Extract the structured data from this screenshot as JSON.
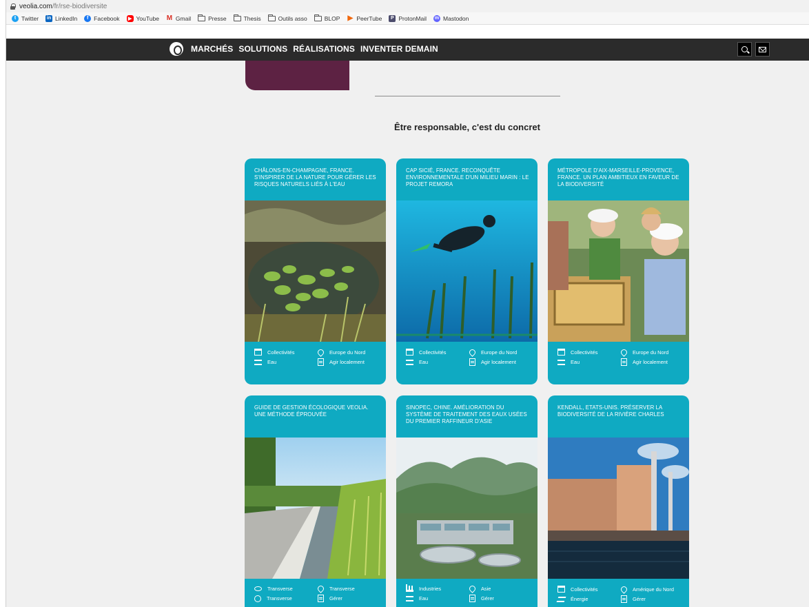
{
  "browser": {
    "url_host": "veolia.com",
    "url_path": "/fr/rse-biodiversite"
  },
  "bookmarks": [
    {
      "label": "Twitter",
      "icon": "twitter-icon",
      "color": "#1da1f2"
    },
    {
      "label": "LinkedIn",
      "icon": "linkedin-icon",
      "color": "#0a66c2"
    },
    {
      "label": "Facebook",
      "icon": "facebook-icon",
      "color": "#1877f2"
    },
    {
      "label": "YouTube",
      "icon": "youtube-icon",
      "color": "#ff0000"
    },
    {
      "label": "Gmail",
      "icon": "gmail-icon",
      "color": "#d93025"
    },
    {
      "label": "Presse",
      "icon": "folder-icon"
    },
    {
      "label": "Thesis",
      "icon": "folder-icon"
    },
    {
      "label": "Outils asso",
      "icon": "folder-icon"
    },
    {
      "label": "BLOP",
      "icon": "folder-icon"
    },
    {
      "label": "PeerTube",
      "icon": "peertube-icon",
      "color": "#f1680d"
    },
    {
      "label": "ProtonMail",
      "icon": "protonmail-icon",
      "color": "#4d4d6d"
    },
    {
      "label": "Mastodon",
      "icon": "mastodon-icon",
      "color": "#6364ff"
    }
  ],
  "nav": {
    "links": [
      "MARCHÉS",
      "SOLUTIONS",
      "RÉALISATIONS",
      "INVENTER DEMAIN"
    ]
  },
  "section_title": "Être responsable, c'est du concret",
  "cards": [
    {
      "title": "CHÂLONS-EN-CHAMPAGNE, FRANCE. S'INSPIRER DE LA NATURE POUR GÉRER LES RISQUES NATURELS LIÉS À L'EAU",
      "tags": [
        {
          "label": "Collectivités",
          "icon": "building-icon"
        },
        {
          "label": "Europe du Nord",
          "icon": "location-icon"
        },
        {
          "label": "Eau",
          "icon": "water-icon"
        },
        {
          "label": "Agir localement",
          "icon": "document-icon"
        }
      ]
    },
    {
      "title": "CAP SICIÉ, FRANCE. RECONQUÊTE ENVIRONNEMENTALE D'UN MILIEU MARIN : LE PROJET REMORA",
      "tags": [
        {
          "label": "Collectivités",
          "icon": "building-icon"
        },
        {
          "label": "Europe du Nord",
          "icon": "location-icon"
        },
        {
          "label": "Eau",
          "icon": "water-icon"
        },
        {
          "label": "Agir localement",
          "icon": "document-icon"
        }
      ]
    },
    {
      "title": "MÉTROPOLE D'AIX-MARSEILLE-PROVENCE, FRANCE. UN PLAN AMBITIEUX EN FAVEUR DE LA BIODIVERSITÉ",
      "tags": [
        {
          "label": "Collectivités",
          "icon": "building-icon"
        },
        {
          "label": "Europe du Nord",
          "icon": "location-icon"
        },
        {
          "label": "Eau",
          "icon": "water-icon"
        },
        {
          "label": "Agir localement",
          "icon": "document-icon"
        }
      ]
    },
    {
      "title": "GUIDE DE GESTION ÉCOLOGIQUE VEOLIA. UNE MÉTHODE ÉPROUVÉE",
      "tags": [
        {
          "label": "Transverse",
          "icon": "eye-icon"
        },
        {
          "label": "Transverse",
          "icon": "location-icon"
        },
        {
          "label": "Transverse",
          "icon": "veolia-circle-icon"
        },
        {
          "label": "Gérer",
          "icon": "document-icon"
        }
      ]
    },
    {
      "title": "SINOPEC, CHINE. AMÉLIORATION DU SYSTÈME DE TRAITEMENT DES EAUX USÉES DU PREMIER RAFFINEUR D'ASIE",
      "tags": [
        {
          "label": "Industries",
          "icon": "factory-icon"
        },
        {
          "label": "Asie",
          "icon": "location-icon"
        },
        {
          "label": "Eau",
          "icon": "water-icon"
        },
        {
          "label": "Gérer",
          "icon": "document-icon"
        }
      ]
    },
    {
      "title": "KENDALL, ETATS-UNIS. PRÉSERVER LA BIODIVERSITÉ DE LA RIVIÈRE CHARLES",
      "tags": [
        {
          "label": "Collectivités",
          "icon": "building-icon"
        },
        {
          "label": "Amérique du Nord",
          "icon": "location-icon"
        },
        {
          "label": "Énergie",
          "icon": "energy-icon"
        },
        {
          "label": "Gérer",
          "icon": "document-icon"
        }
      ]
    }
  ],
  "colors": {
    "nav_bg": "#2b2b2b",
    "card_teal": "#0faac2",
    "accent_purple": "#5d2243"
  }
}
